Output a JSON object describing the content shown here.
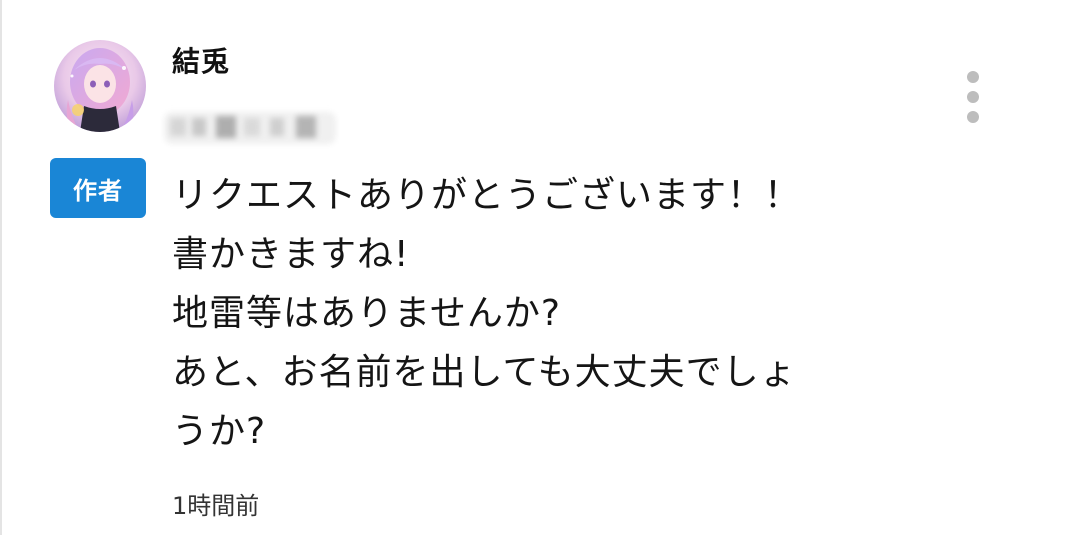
{
  "author": {
    "name": "結兎",
    "badge": "作者"
  },
  "comment": {
    "lines": [
      "リクエストありがとうございます！！",
      "書かきますね!",
      "地雷等はありませんか?",
      "あと、お名前を出しても大丈夫でしょ",
      "うか?"
    ],
    "timestamp": "1時間前"
  },
  "icons": {
    "more": "more-vertical-icon"
  },
  "colors": {
    "badge_background": "#1a86d6",
    "badge_text": "#ffffff",
    "menu_dots": "#bdbdbd",
    "text": "#151515"
  }
}
